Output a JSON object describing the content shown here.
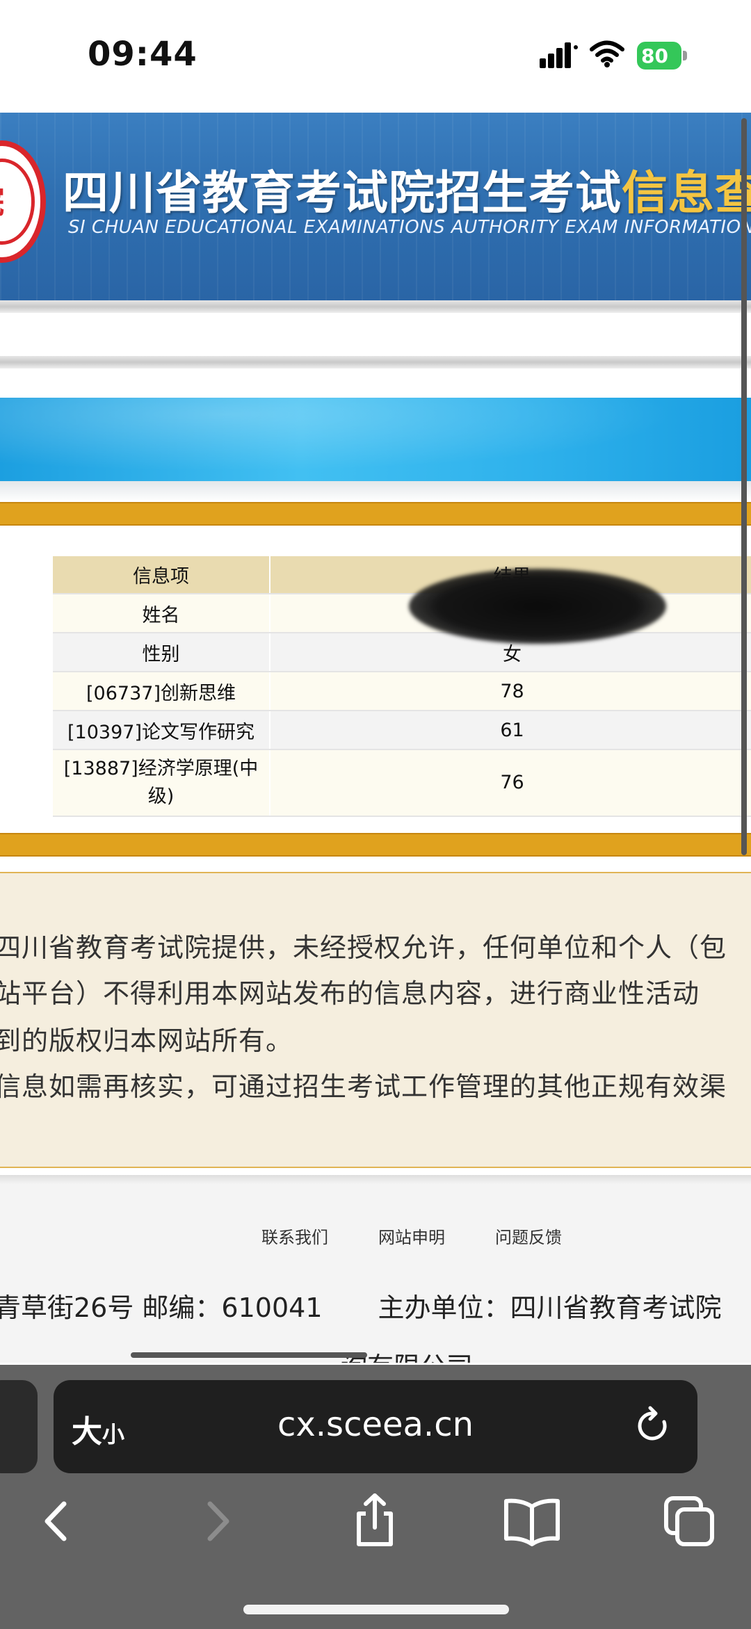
{
  "status_bar": {
    "time": "09:44",
    "battery": "80"
  },
  "banner": {
    "title_main": "四川省教育考试院招生考试",
    "title_highlight": "信息查询",
    "subtitle": "SI CHUAN EDUCATIONAL EXAMINATIONS AUTHORITY EXAM INFORMATION INQUIRY",
    "logo_char": "院"
  },
  "table": {
    "header": [
      "信息项",
      "结果"
    ],
    "rows": [
      {
        "item": "姓名",
        "result": ""
      },
      {
        "item": "性别",
        "result": "女"
      },
      {
        "item": "[06737]创新思维",
        "result": "78"
      },
      {
        "item": "[10397]论文写作研究",
        "result": "61"
      },
      {
        "item_line1": "[13887]经济学原理(中",
        "item_line2": "级)",
        "result": "76"
      }
    ]
  },
  "notice": {
    "lines": [
      "四川省教育考试院提供，未经授权允许，任何单位和个人（包",
      "站平台）不得利用本网站发布的信息内容，进行商业性活动",
      "到的版权归本网站所有。",
      "信息如需再核实，可通过招生考试工作管理的其他正规有效渠"
    ]
  },
  "footer": {
    "links": [
      "联系我们",
      "网站申明",
      "问题反馈"
    ],
    "address": "青草街26号 邮编：610041",
    "organizer": "主办单位：四川省教育考试院",
    "cut_line": "询有限公司"
  },
  "safari": {
    "size_label_big": "大",
    "size_label_small": "小",
    "url": "cx.sceea.cn"
  }
}
